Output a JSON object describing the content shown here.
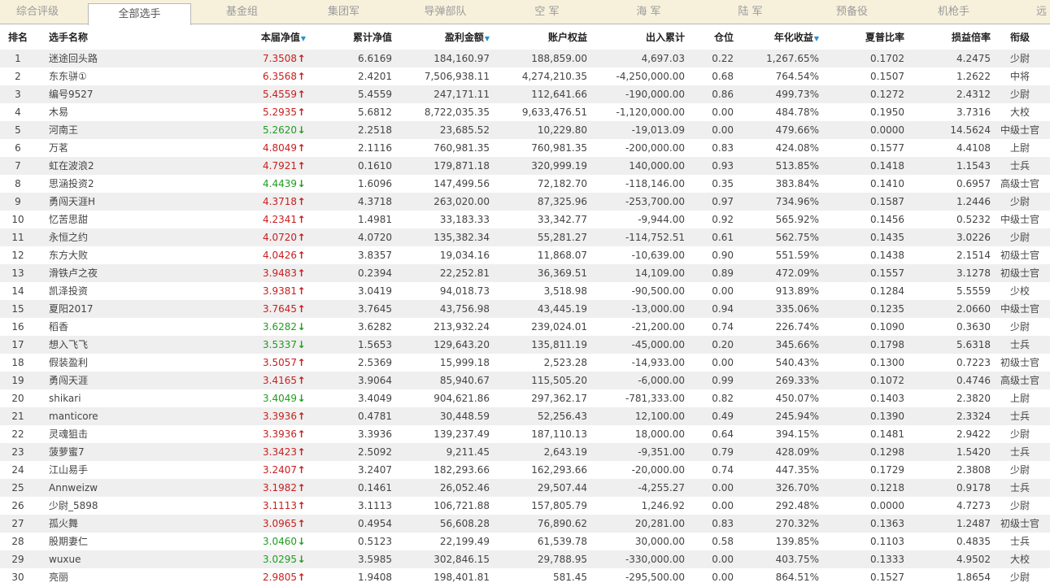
{
  "tabs": [
    {
      "label": "综合评级"
    },
    {
      "label": "全部选手"
    },
    {
      "label": "基金组"
    },
    {
      "label": "集团军"
    },
    {
      "label": "导弹部队"
    },
    {
      "label": "空 军"
    },
    {
      "label": "海 军"
    },
    {
      "label": "陆 军"
    },
    {
      "label": "预备役"
    },
    {
      "label": "机枪手"
    },
    {
      "label": "远"
    }
  ],
  "active_tab": "全部选手",
  "headers": {
    "rank": "排名",
    "name": "选手名称",
    "nav": "本届净值",
    "cum": "累计净值",
    "profit": "盈利金额",
    "equity": "账户权益",
    "flow": "出入累计",
    "pos": "仓位",
    "annual": "年化收益",
    "sharpe": "夏普比率",
    "ratio": "损益倍率",
    "grade": "衔级"
  },
  "colors": {
    "up": "#c81e1e",
    "down": "#1f9d1f",
    "sort": "#2a8fd0"
  },
  "rows": [
    {
      "rank": "1",
      "name": "迷途回头路",
      "nav": "7.3508",
      "dir": "up",
      "cum": "6.6169",
      "profit": "184,160.97",
      "equity": "188,859.00",
      "flow": "4,697.03",
      "pos": "0.22",
      "annual": "1,267.65%",
      "sharpe": "0.1702",
      "ratio": "4.2475",
      "grade": "少尉"
    },
    {
      "rank": "2",
      "name": "东东骈①",
      "nav": "6.3568",
      "dir": "up",
      "cum": "2.4201",
      "profit": "7,506,938.11",
      "equity": "4,274,210.35",
      "flow": "-4,250,000.00",
      "pos": "0.68",
      "annual": "764.54%",
      "sharpe": "0.1507",
      "ratio": "1.2622",
      "grade": "中将"
    },
    {
      "rank": "3",
      "name": "编号9527",
      "nav": "5.4559",
      "dir": "up",
      "cum": "5.4559",
      "profit": "247,171.11",
      "equity": "112,641.66",
      "flow": "-190,000.00",
      "pos": "0.86",
      "annual": "499.73%",
      "sharpe": "0.1272",
      "ratio": "2.4312",
      "grade": "少尉"
    },
    {
      "rank": "4",
      "name": "木易",
      "nav": "5.2935",
      "dir": "up",
      "cum": "5.6812",
      "profit": "8,722,035.35",
      "equity": "9,633,476.51",
      "flow": "-1,120,000.00",
      "pos": "0.00",
      "annual": "484.78%",
      "sharpe": "0.1950",
      "ratio": "3.7316",
      "grade": "大校"
    },
    {
      "rank": "5",
      "name": "河南王",
      "nav": "5.2620",
      "dir": "down",
      "cum": "2.2518",
      "profit": "23,685.52",
      "equity": "10,229.80",
      "flow": "-19,013.09",
      "pos": "0.00",
      "annual": "479.66%",
      "sharpe": "0.0000",
      "ratio": "14.5624",
      "grade": "中级士官"
    },
    {
      "rank": "6",
      "name": "万茗",
      "nav": "4.8049",
      "dir": "up",
      "cum": "2.1116",
      "profit": "760,981.35",
      "equity": "760,981.35",
      "flow": "-200,000.00",
      "pos": "0.83",
      "annual": "424.08%",
      "sharpe": "0.1577",
      "ratio": "4.4108",
      "grade": "上尉"
    },
    {
      "rank": "7",
      "name": "虹在波浪2",
      "nav": "4.7921",
      "dir": "up",
      "cum": "0.1610",
      "profit": "179,871.18",
      "equity": "320,999.19",
      "flow": "140,000.00",
      "pos": "0.93",
      "annual": "513.85%",
      "sharpe": "0.1418",
      "ratio": "1.1543",
      "grade": "士兵"
    },
    {
      "rank": "8",
      "name": "思涵投资2",
      "nav": "4.4439",
      "dir": "down",
      "cum": "1.6096",
      "profit": "147,499.56",
      "equity": "72,182.70",
      "flow": "-118,146.00",
      "pos": "0.35",
      "annual": "383.84%",
      "sharpe": "0.1410",
      "ratio": "0.6957",
      "grade": "高级士官"
    },
    {
      "rank": "9",
      "name": "勇闯天涯H",
      "nav": "4.3718",
      "dir": "up",
      "cum": "4.3718",
      "profit": "263,020.00",
      "equity": "87,325.96",
      "flow": "-253,700.00",
      "pos": "0.97",
      "annual": "734.96%",
      "sharpe": "0.1587",
      "ratio": "1.2446",
      "grade": "少尉"
    },
    {
      "rank": "10",
      "name": "忆苦思甜",
      "nav": "4.2341",
      "dir": "up",
      "cum": "1.4981",
      "profit": "33,183.33",
      "equity": "33,342.77",
      "flow": "-9,944.00",
      "pos": "0.92",
      "annual": "565.92%",
      "sharpe": "0.1456",
      "ratio": "0.5232",
      "grade": "中级士官"
    },
    {
      "rank": "11",
      "name": "永恒之约",
      "nav": "4.0720",
      "dir": "up",
      "cum": "4.0720",
      "profit": "135,382.34",
      "equity": "55,281.27",
      "flow": "-114,752.51",
      "pos": "0.61",
      "annual": "562.75%",
      "sharpe": "0.1435",
      "ratio": "3.0226",
      "grade": "少尉"
    },
    {
      "rank": "12",
      "name": "东方大败",
      "nav": "4.0426",
      "dir": "up",
      "cum": "3.8357",
      "profit": "19,034.16",
      "equity": "11,868.07",
      "flow": "-10,639.00",
      "pos": "0.90",
      "annual": "551.59%",
      "sharpe": "0.1438",
      "ratio": "2.1514",
      "grade": "初级士官"
    },
    {
      "rank": "13",
      "name": "滑铁卢之夜",
      "nav": "3.9483",
      "dir": "up",
      "cum": "0.2394",
      "profit": "22,252.81",
      "equity": "36,369.51",
      "flow": "14,109.00",
      "pos": "0.89",
      "annual": "472.09%",
      "sharpe": "0.1557",
      "ratio": "3.1278",
      "grade": "初级士官"
    },
    {
      "rank": "14",
      "name": "凯泽投资",
      "nav": "3.9381",
      "dir": "up",
      "cum": "3.0419",
      "profit": "94,018.73",
      "equity": "3,518.98",
      "flow": "-90,500.00",
      "pos": "0.00",
      "annual": "913.89%",
      "sharpe": "0.1284",
      "ratio": "5.5559",
      "grade": "少校"
    },
    {
      "rank": "15",
      "name": "夏阳2017",
      "nav": "3.7645",
      "dir": "up",
      "cum": "3.7645",
      "profit": "43,756.98",
      "equity": "43,445.19",
      "flow": "-13,000.00",
      "pos": "0.94",
      "annual": "335.06%",
      "sharpe": "0.1235",
      "ratio": "2.0660",
      "grade": "中级士官"
    },
    {
      "rank": "16",
      "name": "稻香",
      "nav": "3.6282",
      "dir": "down",
      "cum": "3.6282",
      "profit": "213,932.24",
      "equity": "239,024.01",
      "flow": "-21,200.00",
      "pos": "0.74",
      "annual": "226.74%",
      "sharpe": "0.1090",
      "ratio": "0.3630",
      "grade": "少尉"
    },
    {
      "rank": "17",
      "name": "想入飞飞",
      "nav": "3.5337",
      "dir": "down",
      "cum": "1.5653",
      "profit": "129,643.20",
      "equity": "135,811.19",
      "flow": "-45,000.00",
      "pos": "0.20",
      "annual": "345.66%",
      "sharpe": "0.1798",
      "ratio": "5.6318",
      "grade": "士兵"
    },
    {
      "rank": "18",
      "name": "假装盈利",
      "nav": "3.5057",
      "dir": "up",
      "cum": "2.5369",
      "profit": "15,999.18",
      "equity": "2,523.28",
      "flow": "-14,933.00",
      "pos": "0.00",
      "annual": "540.43%",
      "sharpe": "0.1300",
      "ratio": "0.7223",
      "grade": "初级士官"
    },
    {
      "rank": "19",
      "name": "勇闯天涯",
      "nav": "3.4165",
      "dir": "up",
      "cum": "3.9064",
      "profit": "85,940.67",
      "equity": "115,505.20",
      "flow": "-6,000.00",
      "pos": "0.99",
      "annual": "269.33%",
      "sharpe": "0.1072",
      "ratio": "0.4746",
      "grade": "高级士官"
    },
    {
      "rank": "20",
      "name": "shikari",
      "nav": "3.4049",
      "dir": "down",
      "cum": "3.4049",
      "profit": "904,621.86",
      "equity": "297,362.17",
      "flow": "-781,333.00",
      "pos": "0.82",
      "annual": "450.07%",
      "sharpe": "0.1403",
      "ratio": "2.3820",
      "grade": "上尉"
    },
    {
      "rank": "21",
      "name": "manticore",
      "nav": "3.3936",
      "dir": "up",
      "cum": "0.4781",
      "profit": "30,448.59",
      "equity": "52,256.43",
      "flow": "12,100.00",
      "pos": "0.49",
      "annual": "245.94%",
      "sharpe": "0.1390",
      "ratio": "2.3324",
      "grade": "士兵"
    },
    {
      "rank": "22",
      "name": "灵魂狙击",
      "nav": "3.3936",
      "dir": "up",
      "cum": "3.3936",
      "profit": "139,237.49",
      "equity": "187,110.13",
      "flow": "18,000.00",
      "pos": "0.64",
      "annual": "394.15%",
      "sharpe": "0.1481",
      "ratio": "2.9422",
      "grade": "少尉"
    },
    {
      "rank": "23",
      "name": "菠萝蜜7",
      "nav": "3.3423",
      "dir": "up",
      "cum": "2.5092",
      "profit": "9,211.45",
      "equity": "2,643.19",
      "flow": "-9,351.00",
      "pos": "0.79",
      "annual": "428.09%",
      "sharpe": "0.1298",
      "ratio": "1.5420",
      "grade": "士兵"
    },
    {
      "rank": "24",
      "name": "江山易手",
      "nav": "3.2407",
      "dir": "up",
      "cum": "3.2407",
      "profit": "182,293.66",
      "equity": "162,293.66",
      "flow": "-20,000.00",
      "pos": "0.74",
      "annual": "447.35%",
      "sharpe": "0.1729",
      "ratio": "2.3808",
      "grade": "少尉"
    },
    {
      "rank": "25",
      "name": "Annweizw",
      "nav": "3.1982",
      "dir": "up",
      "cum": "0.1461",
      "profit": "26,052.46",
      "equity": "29,507.44",
      "flow": "-4,255.27",
      "pos": "0.00",
      "annual": "326.70%",
      "sharpe": "0.1218",
      "ratio": "0.9178",
      "grade": "士兵"
    },
    {
      "rank": "26",
      "name": "少尉_5898",
      "nav": "3.1113",
      "dir": "up",
      "cum": "3.1113",
      "profit": "106,721.88",
      "equity": "157,805.79",
      "flow": "1,246.92",
      "pos": "0.00",
      "annual": "292.48%",
      "sharpe": "0.0000",
      "ratio": "4.7273",
      "grade": "少尉"
    },
    {
      "rank": "27",
      "name": "孤火舞",
      "nav": "3.0965",
      "dir": "up",
      "cum": "0.4954",
      "profit": "56,608.28",
      "equity": "76,890.62",
      "flow": "20,281.00",
      "pos": "0.83",
      "annual": "270.32%",
      "sharpe": "0.1363",
      "ratio": "1.2487",
      "grade": "初级士官"
    },
    {
      "rank": "28",
      "name": "股期妻仁",
      "nav": "3.0460",
      "dir": "down",
      "cum": "0.5123",
      "profit": "22,199.49",
      "equity": "61,539.78",
      "flow": "30,000.00",
      "pos": "0.58",
      "annual": "139.85%",
      "sharpe": "0.1103",
      "ratio": "0.4835",
      "grade": "士兵"
    },
    {
      "rank": "29",
      "name": "wuxue",
      "nav": "3.0295",
      "dir": "down",
      "cum": "3.5985",
      "profit": "302,846.15",
      "equity": "29,788.95",
      "flow": "-330,000.00",
      "pos": "0.00",
      "annual": "403.75%",
      "sharpe": "0.1333",
      "ratio": "4.9502",
      "grade": "大校"
    },
    {
      "rank": "30",
      "name": "亮丽",
      "nav": "2.9805",
      "dir": "up",
      "cum": "1.9408",
      "profit": "198,401.81",
      "equity": "581.45",
      "flow": "-295,500.00",
      "pos": "0.00",
      "annual": "864.51%",
      "sharpe": "0.1527",
      "ratio": "1.8654",
      "grade": "少尉"
    }
  ]
}
